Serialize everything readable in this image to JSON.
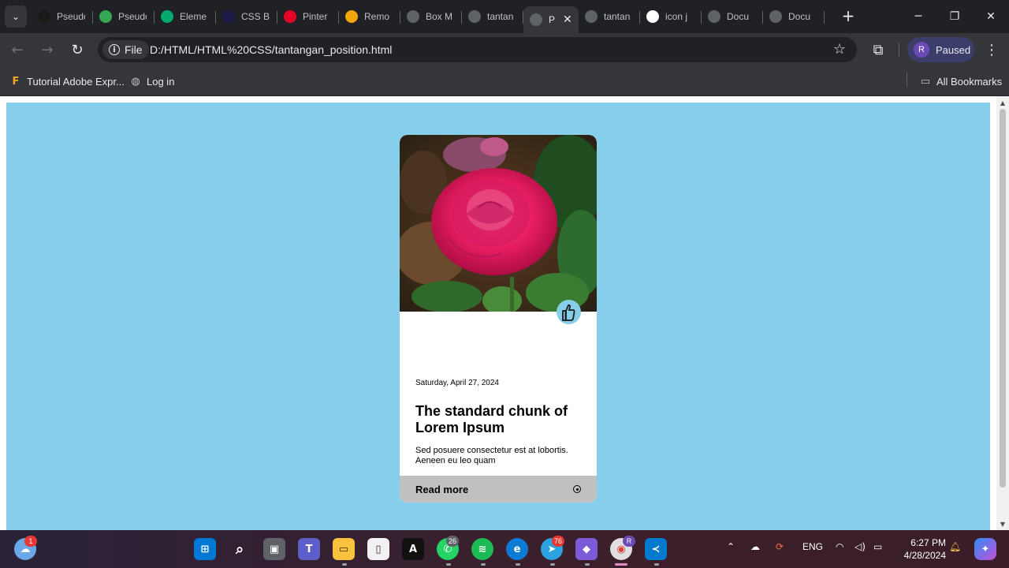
{
  "browser": {
    "tabs": [
      {
        "title": "Pseudo",
        "icon": "pseudo-favicon",
        "color": "#1a1a1a"
      },
      {
        "title": "Pseudo",
        "icon": "gmail-favicon",
        "color": "#34a853"
      },
      {
        "title": "Eleme",
        "icon": "w3schools-favicon",
        "color": "#04aa6d"
      },
      {
        "title": "CSS B",
        "icon": "css-favicon",
        "color": "#1e1b4b"
      },
      {
        "title": "Pinter",
        "icon": "pinterest-favicon",
        "color": "#e60023"
      },
      {
        "title": "Remo",
        "icon": "remote-favicon",
        "color": "#f2a60c"
      },
      {
        "title": "Box M",
        "icon": "globe-favicon",
        "color": "#5f6368"
      },
      {
        "title": "tantan",
        "icon": "globe-favicon",
        "color": "#5f6368"
      },
      {
        "title": "P",
        "icon": "globe-favicon",
        "color": "#5f6368",
        "active": true
      },
      {
        "title": "tantan",
        "icon": "globe-favicon",
        "color": "#5f6368"
      },
      {
        "title": "icon j",
        "icon": "google-favicon",
        "color": "#ffffff"
      },
      {
        "title": "Docu",
        "icon": "globe-favicon",
        "color": "#5f6368"
      },
      {
        "title": "Docu",
        "icon": "globe-favicon",
        "color": "#5f6368"
      }
    ],
    "address": {
      "scheme_label": "File",
      "url": "D:/HTML/HTML%20CSS/tantangan_position.html"
    },
    "profile": {
      "initial": "R",
      "status": "Paused"
    },
    "bookmarks": [
      {
        "label": "Tutorial Adobe Expr...",
        "icon": "adobe-express-icon"
      },
      {
        "label": "Log in",
        "icon": "globe-icon"
      }
    ],
    "all_bookmarks_label": "All Bookmarks"
  },
  "card": {
    "date": "Saturday, April 27, 2024",
    "title": "The standard chunk of Lorem Ipsum",
    "text": "Sed posuere consectetur est at lobortis. Aeneen eu leo quam",
    "read_more": "Read more",
    "image": "pink-rose-photo",
    "accent_color": "#87ceeb",
    "page_background": "#87ceeb"
  },
  "taskbar": {
    "weather_badge": "1",
    "whatsapp_badge": "26",
    "telegram_badge": "76",
    "chrome_badge": "R",
    "language": "ENG",
    "time": "6:27 PM",
    "date": "4/28/2024"
  }
}
